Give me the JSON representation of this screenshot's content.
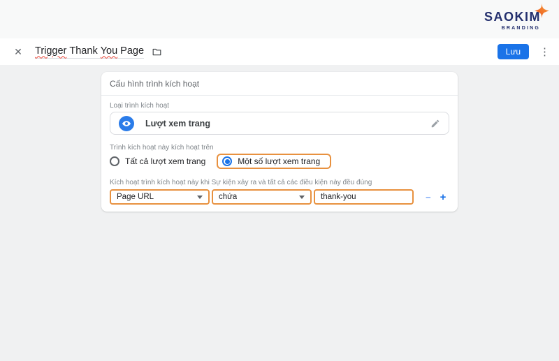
{
  "brand": {
    "name": "SAOKIM",
    "tagline": "BRANDING"
  },
  "header": {
    "title_parts": {
      "p1": "Trigger",
      "p2": "Thank",
      "p3": "You",
      "p4": "Page"
    },
    "save_label": "Lưu"
  },
  "icons": {
    "close": "✕",
    "overflow": "⋮",
    "minus": "−",
    "plus": "+"
  },
  "card": {
    "title": "Cấu hình trình kích hoạt",
    "trigger_type": {
      "label": "Loại trình kích hoạt",
      "value": "Lượt xem trang"
    },
    "fires_on": {
      "label": "Trình kích hoạt này kích hoạt trên",
      "option_all": "Tất cả lượt xem trang",
      "option_some": "Một số lượt xem trang",
      "selected_option": "Một số lượt xem trang"
    },
    "conditions": {
      "label": "Kích hoạt trình kích hoạt này khi Sự kiện xảy ra và tất cả các điều kiện này đều đúng",
      "row": {
        "variable": "Page URL",
        "operator": "chứa",
        "value": "thank-you"
      }
    }
  },
  "colors": {
    "accent_blue": "#1a73e8",
    "highlight_orange": "#e8913f",
    "brand_navy": "#24306e",
    "brand_orange": "#f47b20",
    "page_bg": "#f0f1f2"
  }
}
